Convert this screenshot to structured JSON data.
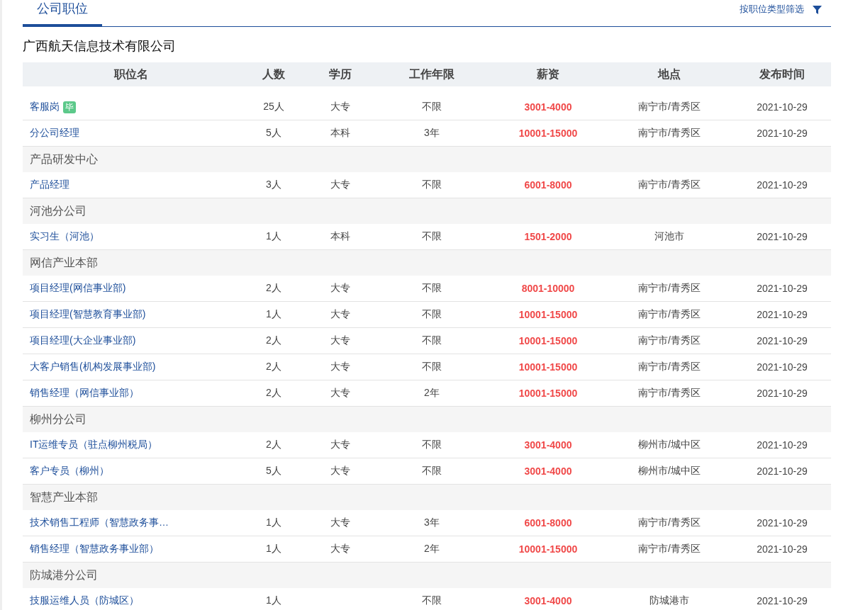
{
  "tabs": [
    {
      "label": "公司职位",
      "selected": true
    }
  ],
  "filter_link": "按职位类型筛选",
  "company": "广西航天信息技术有限公司",
  "table": {
    "columns": [
      "职位名",
      "人数",
      "学历",
      "工作年限",
      "薪资",
      "地点",
      "发布时间"
    ],
    "rows": [
      {
        "kind": "job",
        "name": "客服岗",
        "badge": "毕",
        "count": "25人",
        "education": "大专",
        "experience": "不限",
        "salary": "3001-4000",
        "location": "南宁市/青秀区",
        "date": "2021-10-29"
      },
      {
        "kind": "job",
        "name": "分公司经理",
        "count": "5人",
        "education": "本科",
        "experience": "3年",
        "salary": "10001-15000",
        "location": "南宁市/青秀区",
        "date": "2021-10-29"
      },
      {
        "kind": "group",
        "name": "产品研发中心"
      },
      {
        "kind": "job",
        "name": "产品经理",
        "count": "3人",
        "education": "大专",
        "experience": "不限",
        "salary": "6001-8000",
        "location": "南宁市/青秀区",
        "date": "2021-10-29"
      },
      {
        "kind": "group",
        "name": "河池分公司"
      },
      {
        "kind": "job",
        "name": "实习生（河池）",
        "count": "1人",
        "education": "本科",
        "experience": "不限",
        "salary": "1501-2000",
        "location": "河池市",
        "date": "2021-10-29"
      },
      {
        "kind": "group",
        "name": "网信产业本部"
      },
      {
        "kind": "job",
        "name": "项目经理(网信事业部)",
        "count": "2人",
        "education": "大专",
        "experience": "不限",
        "salary": "8001-10000",
        "location": "南宁市/青秀区",
        "date": "2021-10-29"
      },
      {
        "kind": "job",
        "name": "项目经理(智慧教育事业部)",
        "count": "1人",
        "education": "大专",
        "experience": "不限",
        "salary": "10001-15000",
        "location": "南宁市/青秀区",
        "date": "2021-10-29"
      },
      {
        "kind": "job",
        "name": "项目经理(大企业事业部)",
        "count": "2人",
        "education": "大专",
        "experience": "不限",
        "salary": "10001-15000",
        "location": "南宁市/青秀区",
        "date": "2021-10-29"
      },
      {
        "kind": "job",
        "name": "大客户销售(机构发展事业部)",
        "count": "2人",
        "education": "大专",
        "experience": "不限",
        "salary": "10001-15000",
        "location": "南宁市/青秀区",
        "date": "2021-10-29"
      },
      {
        "kind": "job",
        "name": "销售经理（网信事业部）",
        "count": "2人",
        "education": "大专",
        "experience": "2年",
        "salary": "10001-15000",
        "location": "南宁市/青秀区",
        "date": "2021-10-29"
      },
      {
        "kind": "group",
        "name": "柳州分公司"
      },
      {
        "kind": "job",
        "name": "IT运维专员（驻点柳州税局）",
        "count": "2人",
        "education": "大专",
        "experience": "不限",
        "salary": "3001-4000",
        "location": "柳州市/城中区",
        "date": "2021-10-29"
      },
      {
        "kind": "job",
        "name": "客户专员（柳州）",
        "count": "5人",
        "education": "大专",
        "experience": "不限",
        "salary": "3001-4000",
        "location": "柳州市/城中区",
        "date": "2021-10-29"
      },
      {
        "kind": "group",
        "name": "智慧产业本部"
      },
      {
        "kind": "job",
        "name": "技术销售工程师（智慧政务事…",
        "count": "1人",
        "education": "大专",
        "experience": "3年",
        "salary": "6001-8000",
        "location": "南宁市/青秀区",
        "date": "2021-10-29"
      },
      {
        "kind": "job",
        "name": "销售经理（智慧政务事业部）",
        "count": "1人",
        "education": "大专",
        "experience": "2年",
        "salary": "10001-15000",
        "location": "南宁市/青秀区",
        "date": "2021-10-29"
      },
      {
        "kind": "group",
        "name": "防城港分公司"
      },
      {
        "kind": "job",
        "name": "技服运维人员（防城区）",
        "count": "1人",
        "experience": "不限",
        "salary": "3001-4000",
        "location": "防城港市",
        "date": "2021-10-29"
      }
    ]
  }
}
